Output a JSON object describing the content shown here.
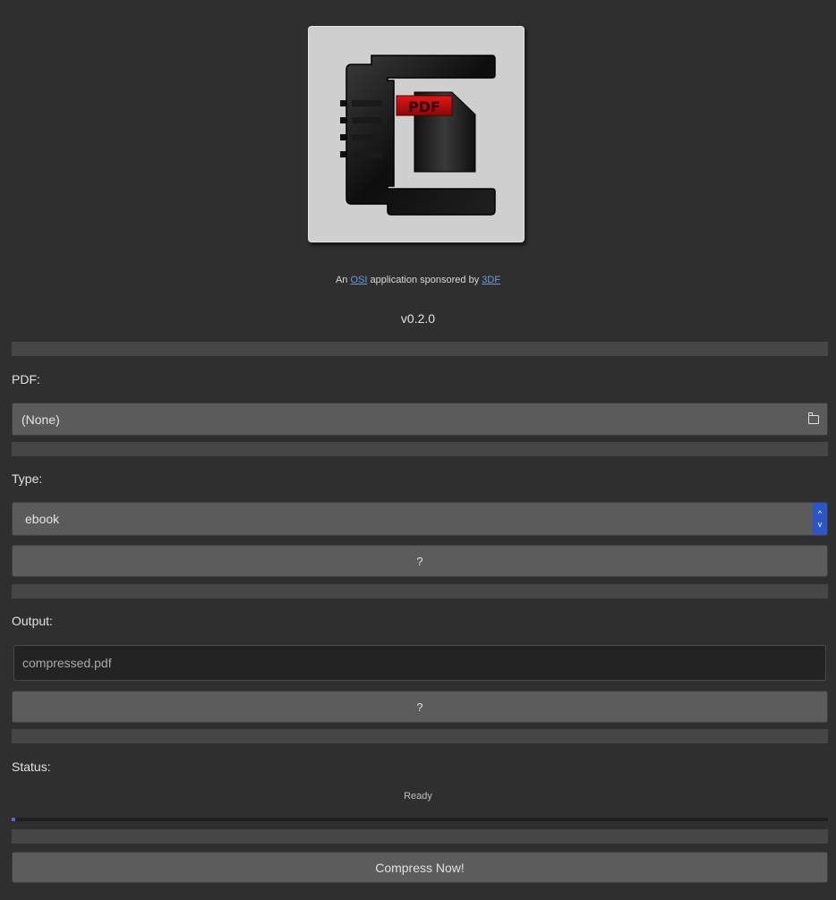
{
  "header": {
    "logo_text": "PDF",
    "sponsor": {
      "prefix": "An",
      "link1": "OSI",
      "middle": "application sponsored by",
      "link2": "3DF"
    },
    "version": "v0.2.0"
  },
  "pdf": {
    "label": "PDF:",
    "value": "(None)",
    "icon": "folder-icon"
  },
  "type": {
    "label": "Type:",
    "selected": "ebook",
    "help_label": "?",
    "spinner_up": "^",
    "spinner_down": "v"
  },
  "output": {
    "label": "Output:",
    "value": "compressed.pdf",
    "help_label": "?"
  },
  "status": {
    "label": "Status:",
    "text": "Ready",
    "progress": 0.004
  },
  "actions": {
    "compress_label": "Compress Now!"
  },
  "colors": {
    "background": "#2f2f2f",
    "accent": "#2c56c8",
    "link": "#6a9ad8"
  }
}
